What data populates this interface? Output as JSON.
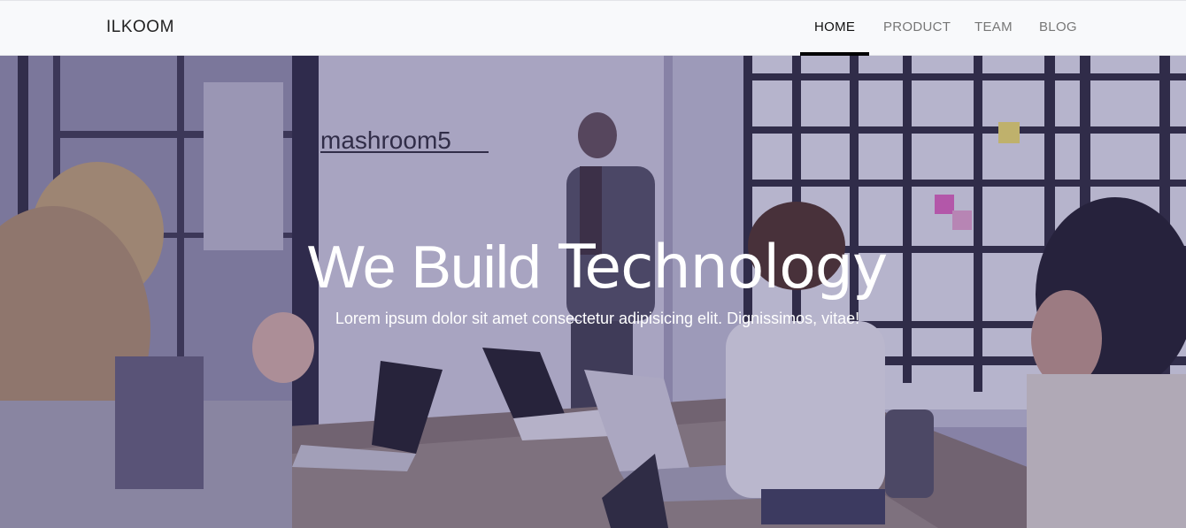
{
  "navbar": {
    "brand": "ILKOOM",
    "links": [
      {
        "label": "HOME",
        "active": true
      },
      {
        "label": "PRODUCT",
        "active": false
      },
      {
        "label": "TEAM",
        "active": false
      },
      {
        "label": "BLOG",
        "active": false
      }
    ]
  },
  "hero": {
    "headline_light": "We Build",
    "headline_bold": "Technology",
    "subtitle": "Lorem ipsum dolor sit amet consectetur adipisicing elit. Dignissimos, vitae!",
    "wall_sign": "mashroom5"
  },
  "colors": {
    "navbar_bg": "#f8f9fb",
    "active_underline": "#000000",
    "overlay": "#6a5fa0"
  }
}
